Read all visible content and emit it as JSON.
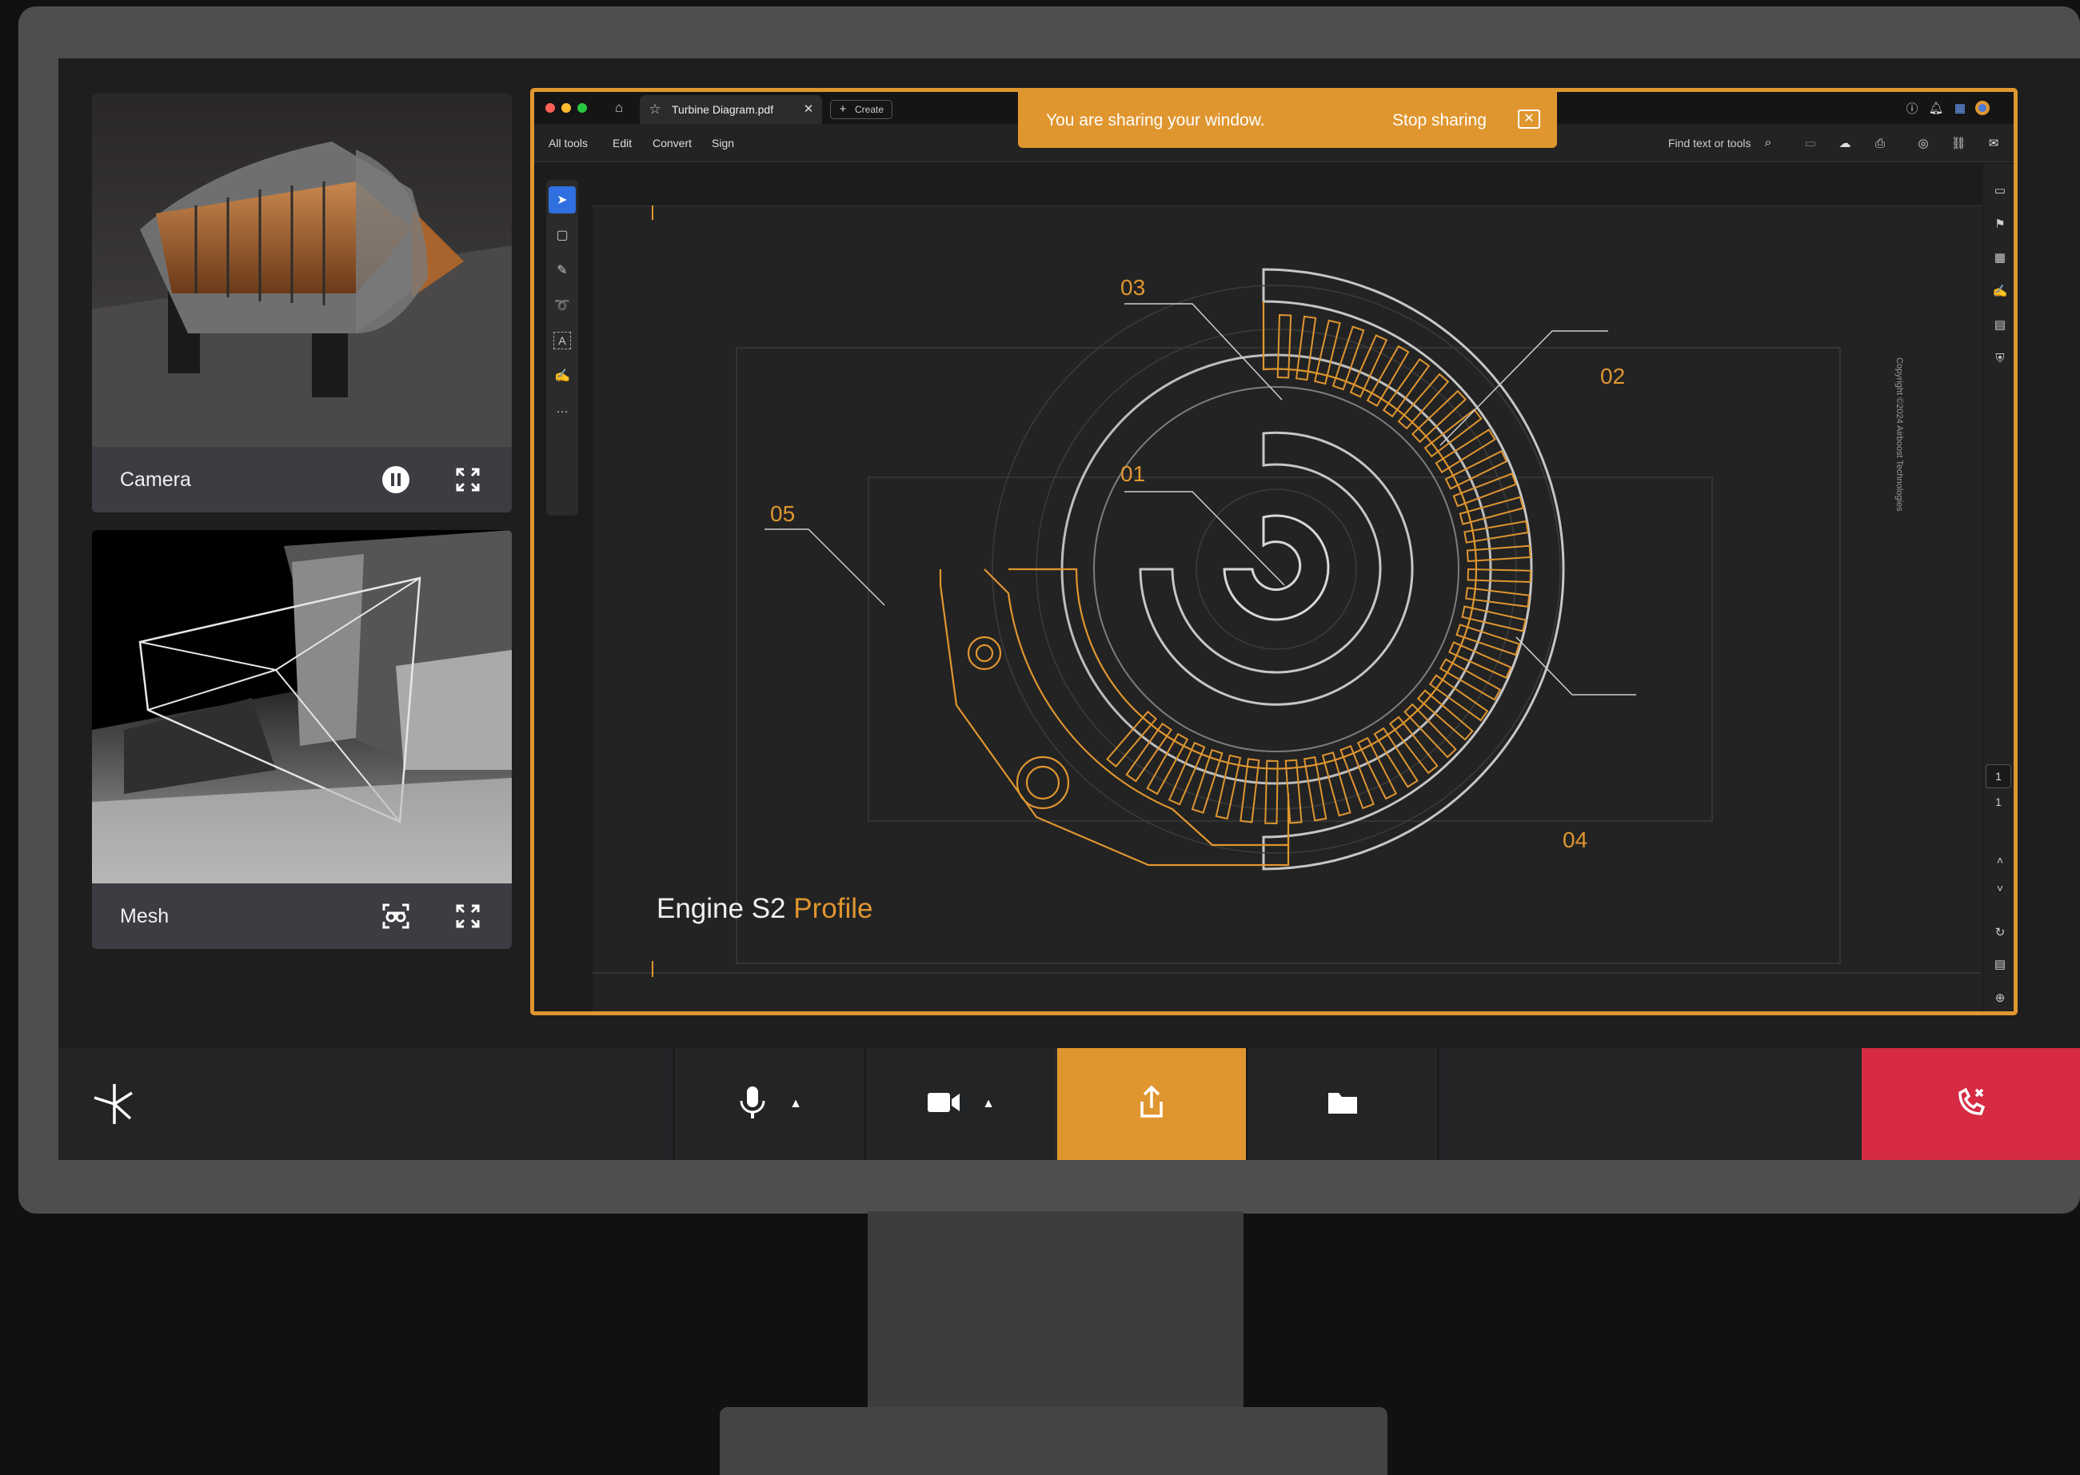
{
  "tiles": {
    "camera": {
      "label": "Camera",
      "pause_icon": "pause-icon",
      "expand_icon": "expand-icon"
    },
    "mesh": {
      "label": "Mesh",
      "view_icon": "vr-glasses-icon",
      "expand_icon": "expand-icon"
    }
  },
  "shared_window": {
    "tab_title": "Turbine Diagram.pdf",
    "new_tab_label": "Create",
    "menu": [
      "All tools",
      "Edit",
      "Convert",
      "Sign"
    ],
    "search_label": "Find text or tools",
    "banner": {
      "message": "You are sharing your window.",
      "stop_label": "Stop sharing",
      "close_symbol": "✕"
    },
    "document": {
      "title_main": "Engine S2",
      "title_accent": "Profile",
      "callouts": [
        "01",
        "02",
        "03",
        "04",
        "05"
      ],
      "copyright": "Copyright ©2024 Airboost Technologies"
    },
    "page_current": "1",
    "page_total": "1"
  },
  "callbar": {
    "logo_icon": "asterisk-logo-icon",
    "mic_icon": "microphone-icon",
    "camera_icon": "video-camera-icon",
    "share_icon": "share-screen-icon",
    "files_icon": "folder-icon",
    "hangup_icon": "hang-up-icon"
  },
  "colors": {
    "accent": "#e0962f",
    "hangup": "#d62b43",
    "screen_bg": "#1e1e1e",
    "bezel": "#4e4e4e"
  }
}
